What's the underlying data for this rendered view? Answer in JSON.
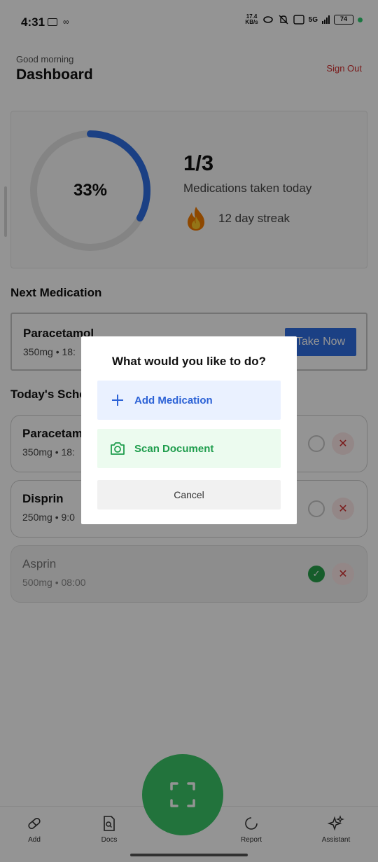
{
  "status_bar": {
    "time": "4:31",
    "net_speed_value": "17.4",
    "net_speed_unit": "KB/s",
    "network": "5G",
    "battery": "74"
  },
  "header": {
    "greeting": "Good morning",
    "title": "Dashboard",
    "sign_out": "Sign Out"
  },
  "progress": {
    "percent_label": "33%",
    "fraction": 0.33,
    "ratio": "1/3",
    "taken_label": "Medications taken today",
    "streak": "12 day streak",
    "streak_icon": "flame-icon",
    "colors": {
      "ring_track": "#e3e3e3",
      "ring_fill": "#2f6fe4"
    }
  },
  "next_medication": {
    "section_title": "Next Medication",
    "name": "Paracetamol",
    "detail": "350mg • 18:",
    "button": "Take Now"
  },
  "schedule": {
    "section_title": "Today's Sche",
    "items": [
      {
        "name": "Paracetam",
        "detail": "350mg • 18:",
        "taken": false
      },
      {
        "name": "Disprin",
        "detail": "250mg • 9:0",
        "taken": false
      },
      {
        "name": "Asprin",
        "detail": "500mg • 08:00",
        "taken": true
      }
    ]
  },
  "bottom_nav": {
    "items": [
      {
        "label": "Add",
        "icon": "pill-icon"
      },
      {
        "label": "Docs",
        "icon": "document-search-icon"
      },
      {
        "label": "Report",
        "icon": "refresh-circle-icon"
      },
      {
        "label": "Assistant",
        "icon": "sparkles-icon"
      }
    ],
    "fab_icon": "scan-frame-icon"
  },
  "dialog": {
    "title": "What would you like to do?",
    "options": [
      {
        "label": "Add Medication",
        "icon": "plus-icon"
      },
      {
        "label": "Scan Document",
        "icon": "camera-icon"
      }
    ],
    "cancel": "Cancel"
  }
}
